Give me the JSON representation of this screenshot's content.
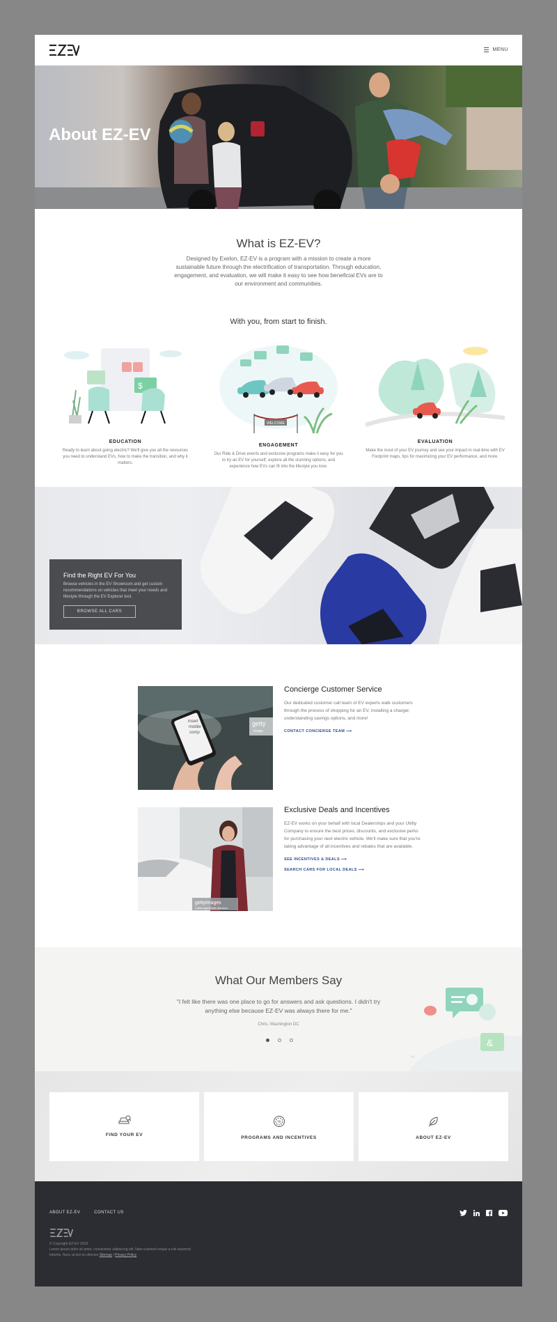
{
  "header": {
    "logo_text": "EZEV",
    "menu_label": "MENU"
  },
  "hero": {
    "title": "About EZ-EV"
  },
  "about": {
    "title": "What is EZ-EV?",
    "body": "Designed by Exelon, EZ-EV is a program with a mission to create a more sustainable future through the electrification of transportation. Through education, engagement, and evaluation, we will make it easy to see how beneficial EVs are to our environment and communities.",
    "subtitle": "With you, from start to finish."
  },
  "features": [
    {
      "title": "EDUCATION",
      "desc": "Ready to learn about going electric? We'll give you all the resources you need to understand EVs, how to make the transition, and why it matters."
    },
    {
      "title": "ENGAGEMENT",
      "desc": "Our Ride & Drive events and exclusive programs make it easy for you to try an EV for yourself, explore all the stunning options, and experience how EVs can fit into the lifestyle you love.",
      "sign": "WELCOME"
    },
    {
      "title": "EVALUATION",
      "desc": "Make the most of your EV journey and see your impact in real-time with EV Footprint maps, tips for maximizing your EV performance, and more."
    }
  ],
  "find_ev": {
    "title": "Find the Right EV For You",
    "body": "Browse vehicles in the EV Showroom and get custom recommendations on vehicles that meet your needs and lifestyle through the EV Explorer tool.",
    "button": "BROWSE ALL CARS"
  },
  "services": [
    {
      "title": "Concierge Customer Service",
      "body": "Our dedicated customer call team of EV experts walk customers through the process of shopping for an EV, installing a charger, understanding savings options, and more!",
      "links": [
        "CONTACT CONCIERGE TEAM ⟶"
      ],
      "image_text": [
        "insert",
        "mobile",
        "comp",
        "getty",
        "Image"
      ]
    },
    {
      "title": "Exclusive Deals and Incentives",
      "body": "EZ-EV works on your behalf with local Dealerships and your Utility Company to ensure the best prices, discounts, and exclusive perks for purchasing your next electric vehicle. We'll make sure that you're taking advantage of all incentives and rebates that are available.",
      "links": [
        "SEE INCENTIVES & DEALS ⟶",
        "SEARCH CARS FOR LOCAL DEALS ⟶"
      ],
      "image_text": [
        "gettyimages",
        "Caiaimage/Martin Barraud"
      ]
    }
  ],
  "members": {
    "title": "What Our Members Say",
    "quote": "\"I felt like there was one place to go for answers and ask questions. I didn't try anything else because EZ-EV was always there for me.\"",
    "author": "Chris, Washington DC",
    "active_slide": 1,
    "slide_count": 3
  },
  "cards": [
    {
      "label": "FIND YOUR EV",
      "icon": "car-search-icon"
    },
    {
      "label": "PROGRAMS AND INCENTIVES",
      "icon": "percent-badge-icon"
    },
    {
      "label": "ABOUT EZ-EV",
      "icon": "leaf-plug-icon"
    }
  ],
  "footer": {
    "links": [
      "ABOUT EZ-EV",
      "CONTACT US"
    ],
    "copyright": "© Copyright EZ-EV 2019",
    "legal": "Lorem ipsum dolor sit amet, consectetur adipiscing elit. Nam euismod neque a nisl euismod lobortis. Nunc at nisi eu ultricies",
    "sitemap": "Sitemap",
    "separator": "|",
    "privacy": "Privacy Policy",
    "social": [
      "twitter-icon",
      "linkedin-icon",
      "facebook-icon",
      "youtube-icon"
    ]
  },
  "colors": {
    "accent_link": "#2a4a8a",
    "footer_bg": "#2c2d33",
    "find_card": "#4b4c50",
    "mint": "#8fd4bc",
    "car_red": "#e85a4f"
  }
}
